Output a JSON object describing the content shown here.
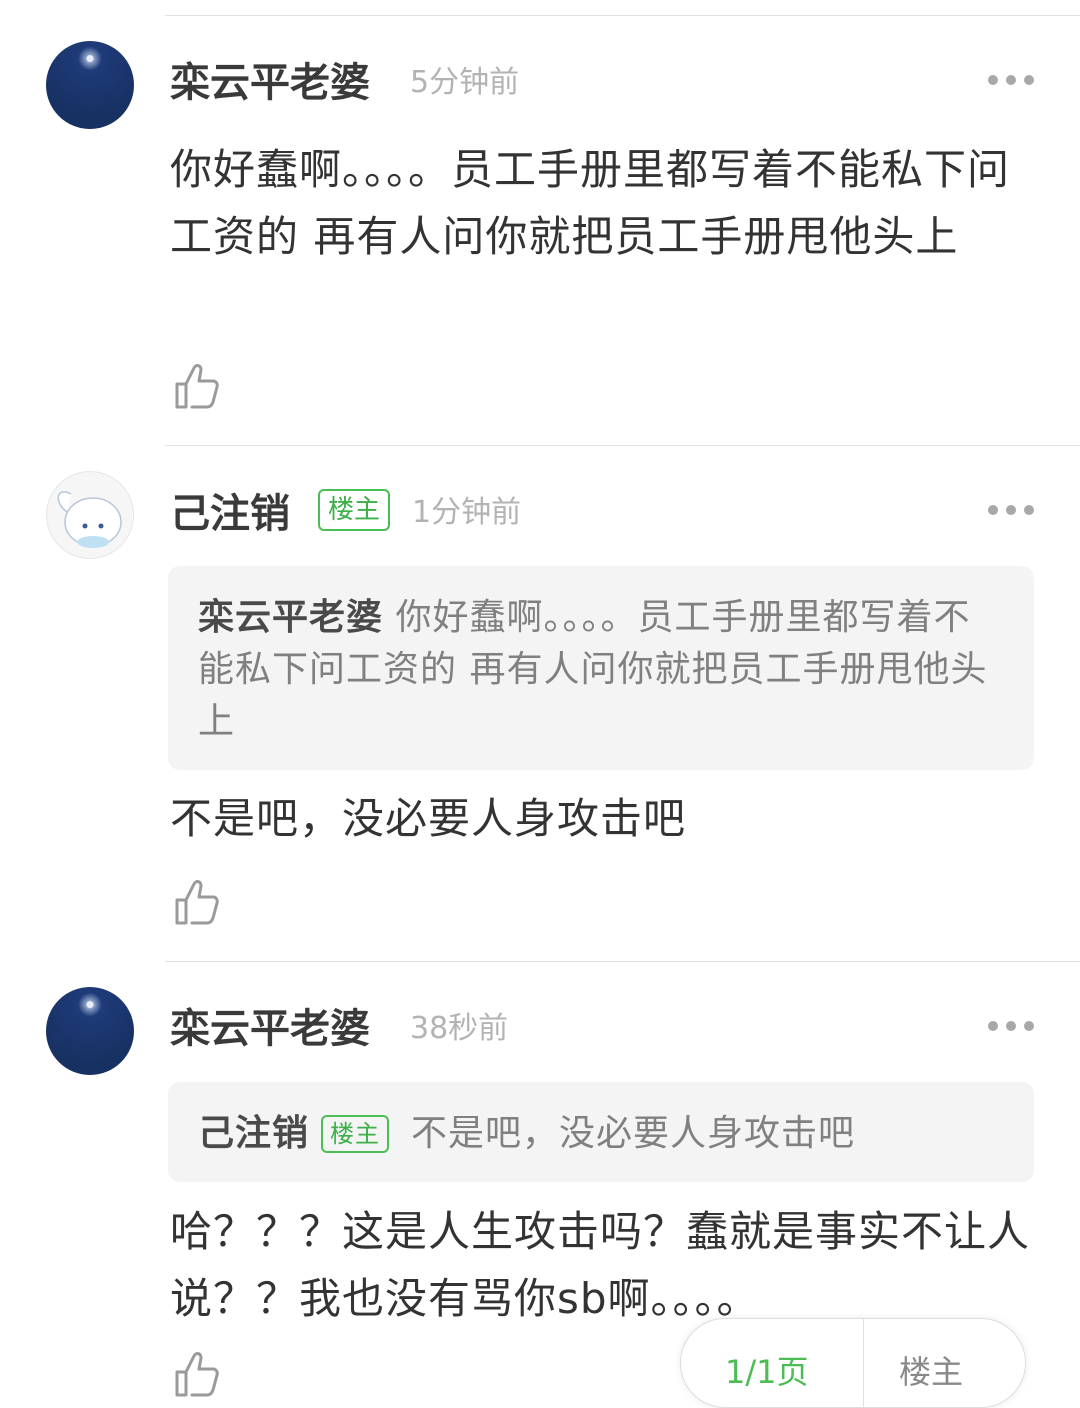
{
  "comments": [
    {
      "author": "栾云平老婆",
      "time": "5分钟前",
      "text": "你好蠢啊。。。。员工手册里都写着不能私下问工资的 再有人问你就把员工手册甩他头上"
    },
    {
      "author": "己注销",
      "badge": "楼主",
      "time": "1分钟前",
      "quote_author": "栾云平老婆",
      "quote_text": "你好蠢啊。。。。员工手册里都写着不能私下问工资的 再有人问你就把员工手册甩他头上",
      "text": "不是吧，没必要人身攻击吧"
    },
    {
      "author": "栾云平老婆",
      "time": "38秒前",
      "quote_author": "己注销",
      "quote_badge": "楼主",
      "quote_text": "不是吧，没必要人身攻击吧",
      "text": "哈？？？这是人生攻击吗？蠢就是事实不让人说？？我也没有骂你sb啊。。。。"
    }
  ],
  "pager": {
    "page": "1/1页",
    "owner_only": "楼主"
  },
  "colors": {
    "badge_green": "#4cbd54",
    "avatar_navy": "#1e3a78"
  }
}
